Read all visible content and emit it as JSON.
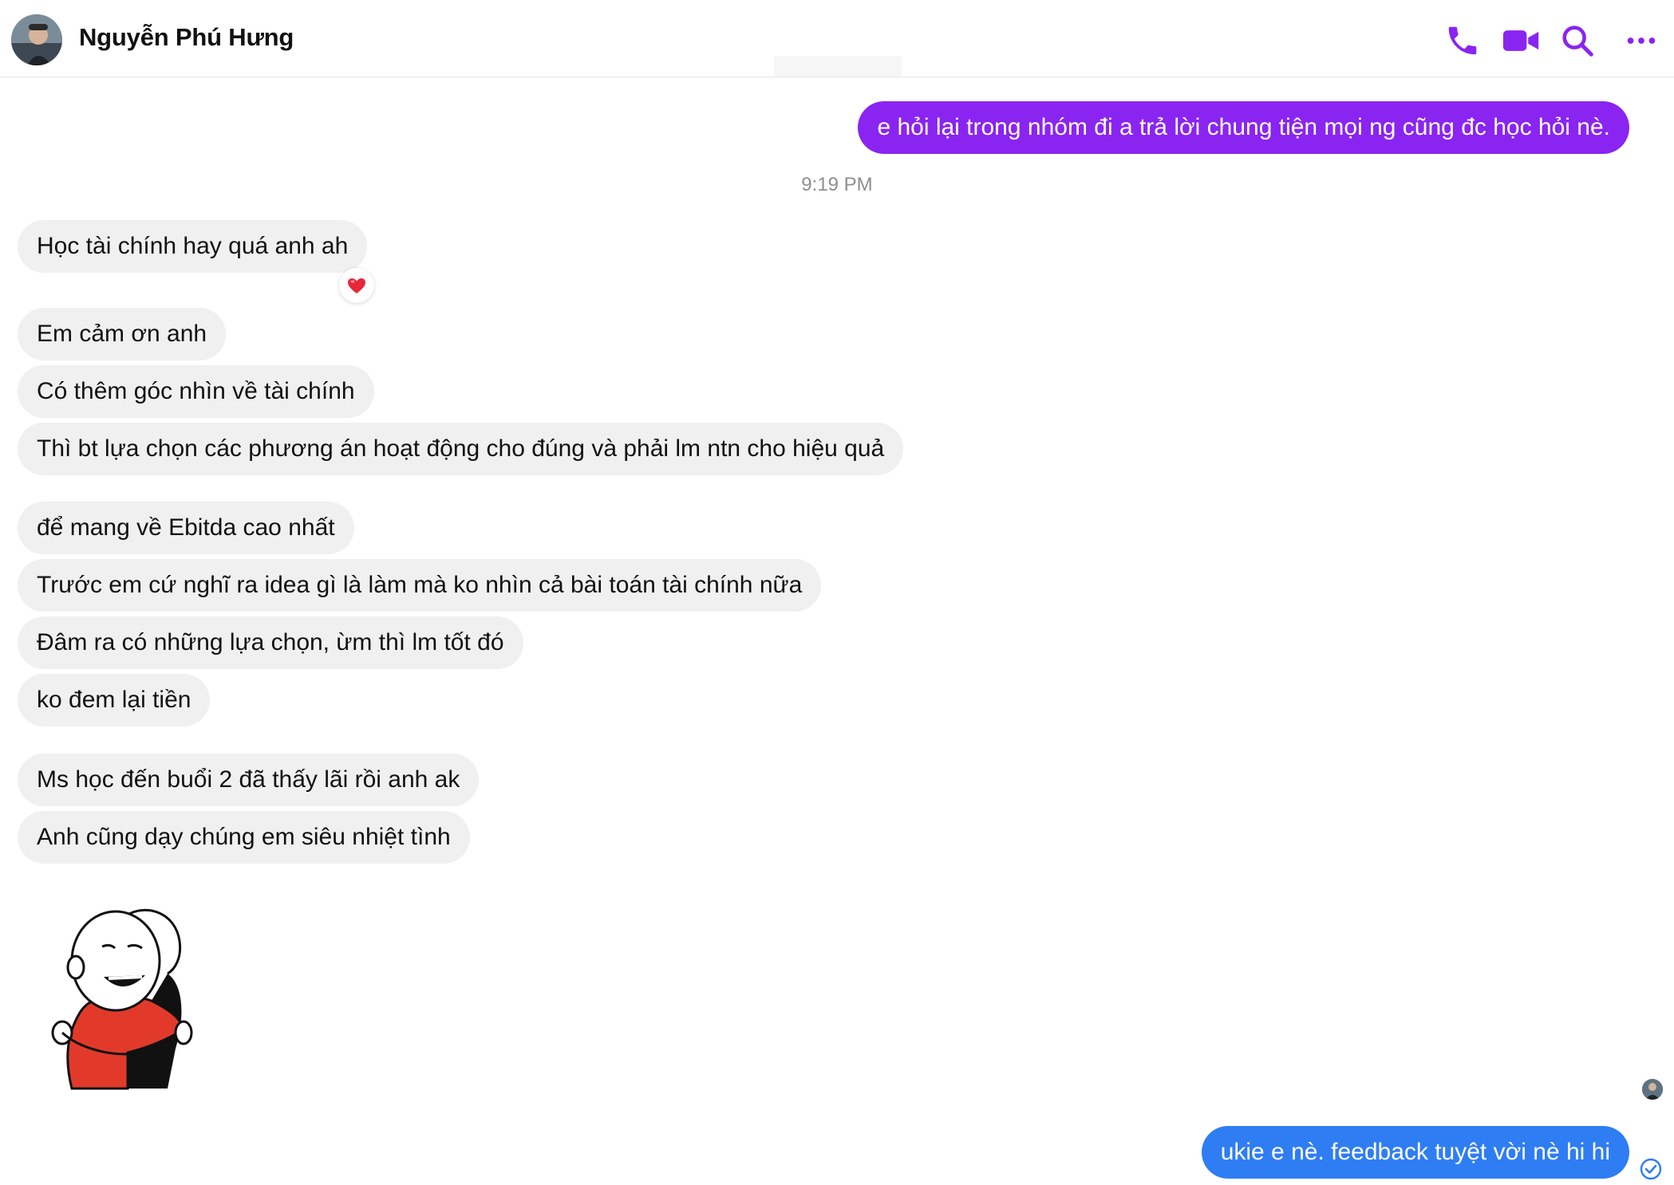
{
  "header": {
    "contact_name": "Nguyễn Phú Hưng",
    "icons": [
      "phone-icon",
      "video-icon",
      "search-icon",
      "more-icon"
    ],
    "accent": "#8a24f1"
  },
  "messages": {
    "sent_1": "e hỏi lại trong nhóm đi a trả lời chung tiện mọi ng cũng đc học hỏi nè.",
    "timestamp": "9:19 PM",
    "received": [
      "Học tài chính hay quá anh ah",
      "Em cảm ơn anh",
      "Có thêm góc nhìn về tài chính",
      "Thì bt lựa chọn các phương án hoạt động cho đúng và phải lm ntn cho hiệu quả",
      "để mang về Ebitda cao nhất",
      "Trước em cứ nghĩ ra idea gì là làm mà ko nhìn cả bài toán tài chính nữa",
      "Đâm ra có những lựa chọn, ừm thì lm tốt đó",
      "ko đem lại tiền",
      "Ms học đến buổi 2 đã thấy lãi rồi anh ak",
      "Anh cũng dạy chúng em siêu nhiệt tình"
    ],
    "reaction": "❤️",
    "sticker": "hug-sticker",
    "sent_2": "ukie e nè. feedback tuyệt vời nè hi hi"
  },
  "colors": {
    "sent_purple": "#8a24f1",
    "sent_blue": "#2f7df3",
    "received_bg": "#f0f0f0"
  }
}
